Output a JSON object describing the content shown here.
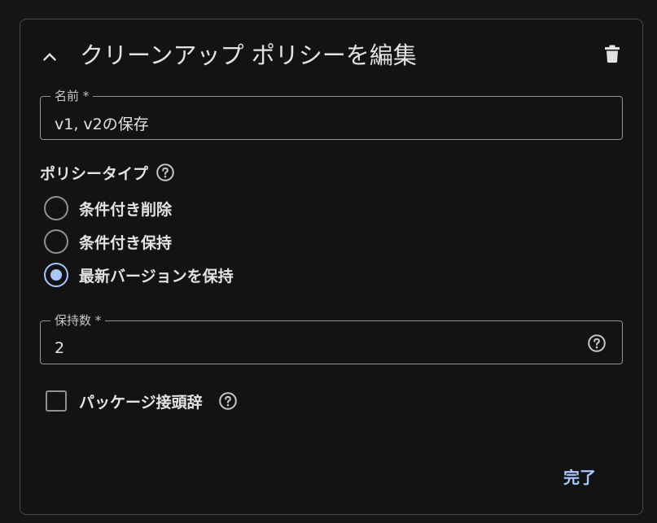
{
  "panel": {
    "title": "クリーンアップ ポリシーを編集",
    "collapse_icon": "chevron-up-icon",
    "delete_icon": "trash-icon"
  },
  "name_field": {
    "label": "名前 *",
    "value": "v1, v2の保存"
  },
  "policy_type": {
    "label": "ポリシータイプ",
    "help_icon": "help-circle-icon",
    "options": [
      {
        "label": "条件付き削除",
        "selected": false
      },
      {
        "label": "条件付き保持",
        "selected": false
      },
      {
        "label": "最新バージョンを保持",
        "selected": true
      }
    ]
  },
  "keep_count_field": {
    "label": "保持数 *",
    "value": "2",
    "help_icon": "help-circle-icon"
  },
  "package_prefix": {
    "label": "パッケージ接頭辞",
    "checked": false,
    "help_icon": "help-circle-icon"
  },
  "actions": {
    "done_label": "完了"
  },
  "colors": {
    "background": "#131314",
    "border": "#47484b",
    "text": "#e3e3e3",
    "accent": "#a8c7fa",
    "outline": "#8e9195"
  }
}
